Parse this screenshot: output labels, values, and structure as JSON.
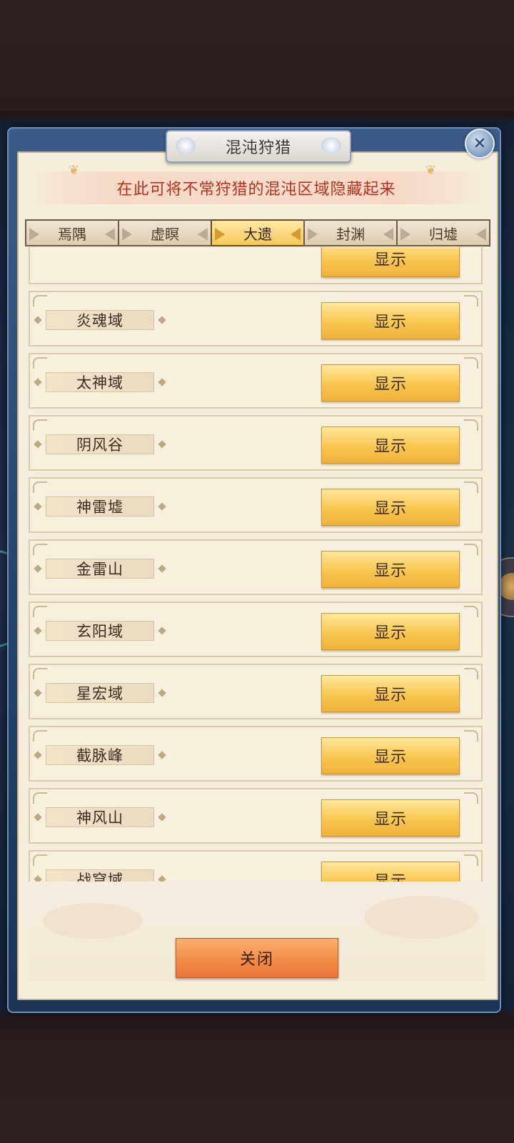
{
  "title": "混沌狩猎",
  "notice": "在此可将不常狩猎的混沌区域隐藏起来",
  "tabs": [
    {
      "label": "焉隅",
      "active": false
    },
    {
      "label": "虚瞑",
      "active": false
    },
    {
      "label": "大遗",
      "active": true
    },
    {
      "label": "封渊",
      "active": false
    },
    {
      "label": "归墟",
      "active": false
    }
  ],
  "areas": [
    {
      "name": "",
      "button": "显示"
    },
    {
      "name": "炎魂域",
      "button": "显示"
    },
    {
      "name": "太神域",
      "button": "显示"
    },
    {
      "name": "阴风谷",
      "button": "显示"
    },
    {
      "name": "神雷墟",
      "button": "显示"
    },
    {
      "name": "金雷山",
      "button": "显示"
    },
    {
      "name": "玄阳域",
      "button": "显示"
    },
    {
      "name": "星宏域",
      "button": "显示"
    },
    {
      "name": "截脉峰",
      "button": "显示"
    },
    {
      "name": "神风山",
      "button": "显示"
    },
    {
      "name": "战穹域",
      "button": "显示"
    }
  ],
  "close_button": "关闭",
  "icons": {
    "close": "close-icon",
    "butterfly": "butterfly-icon"
  },
  "colors": {
    "notice_text": "#b4321e",
    "show_button": "#f9c650",
    "close_button": "#f18a45",
    "active_tab": "#f7c65a"
  }
}
